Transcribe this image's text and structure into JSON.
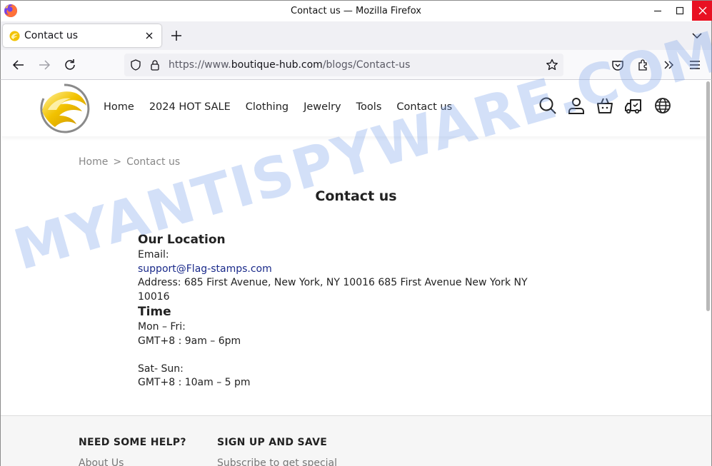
{
  "window": {
    "title": "Contact us — Mozilla Firefox"
  },
  "tab": {
    "label": "Contact us"
  },
  "urlbar": {
    "prefix": "https://www.",
    "domain": "boutique-hub.com",
    "path": "/blogs/Contact-us"
  },
  "header": {
    "menu": [
      "Home",
      "2024 HOT SALE",
      "Clothing",
      "Jewelry",
      "Tools",
      "Contact us"
    ]
  },
  "breadcrumb": {
    "home": "Home",
    "separator": ">",
    "current": "Contact us"
  },
  "page": {
    "title": "Contact us",
    "location_heading": "Our Location",
    "email_label": "Email:",
    "email": "support@Flag-stamps.com",
    "address_line1": "Address:  685 First Avenue, New York, NY 10016 685 First Avenue New York NY",
    "address_line2": "10016",
    "time_heading": "Time",
    "weekday_label": "Mon – Fri:",
    "weekday_hours": "GMT+8 : 9am – 6pm",
    "weekend_label": "Sat- Sun:",
    "weekend_hours": "GMT+8 : 10am – 5 pm"
  },
  "footer": {
    "help_heading": "NEED SOME HELP?",
    "help_link": "About Us",
    "signup_heading": "SIGN UP AND SAVE",
    "signup_text": "Subscribe to get special"
  },
  "watermark": "MYANTISPYWARE.COM",
  "colors": {
    "close_button": "#e81123",
    "link": "#1a2a8a",
    "logo_gold": "#f2c200"
  }
}
